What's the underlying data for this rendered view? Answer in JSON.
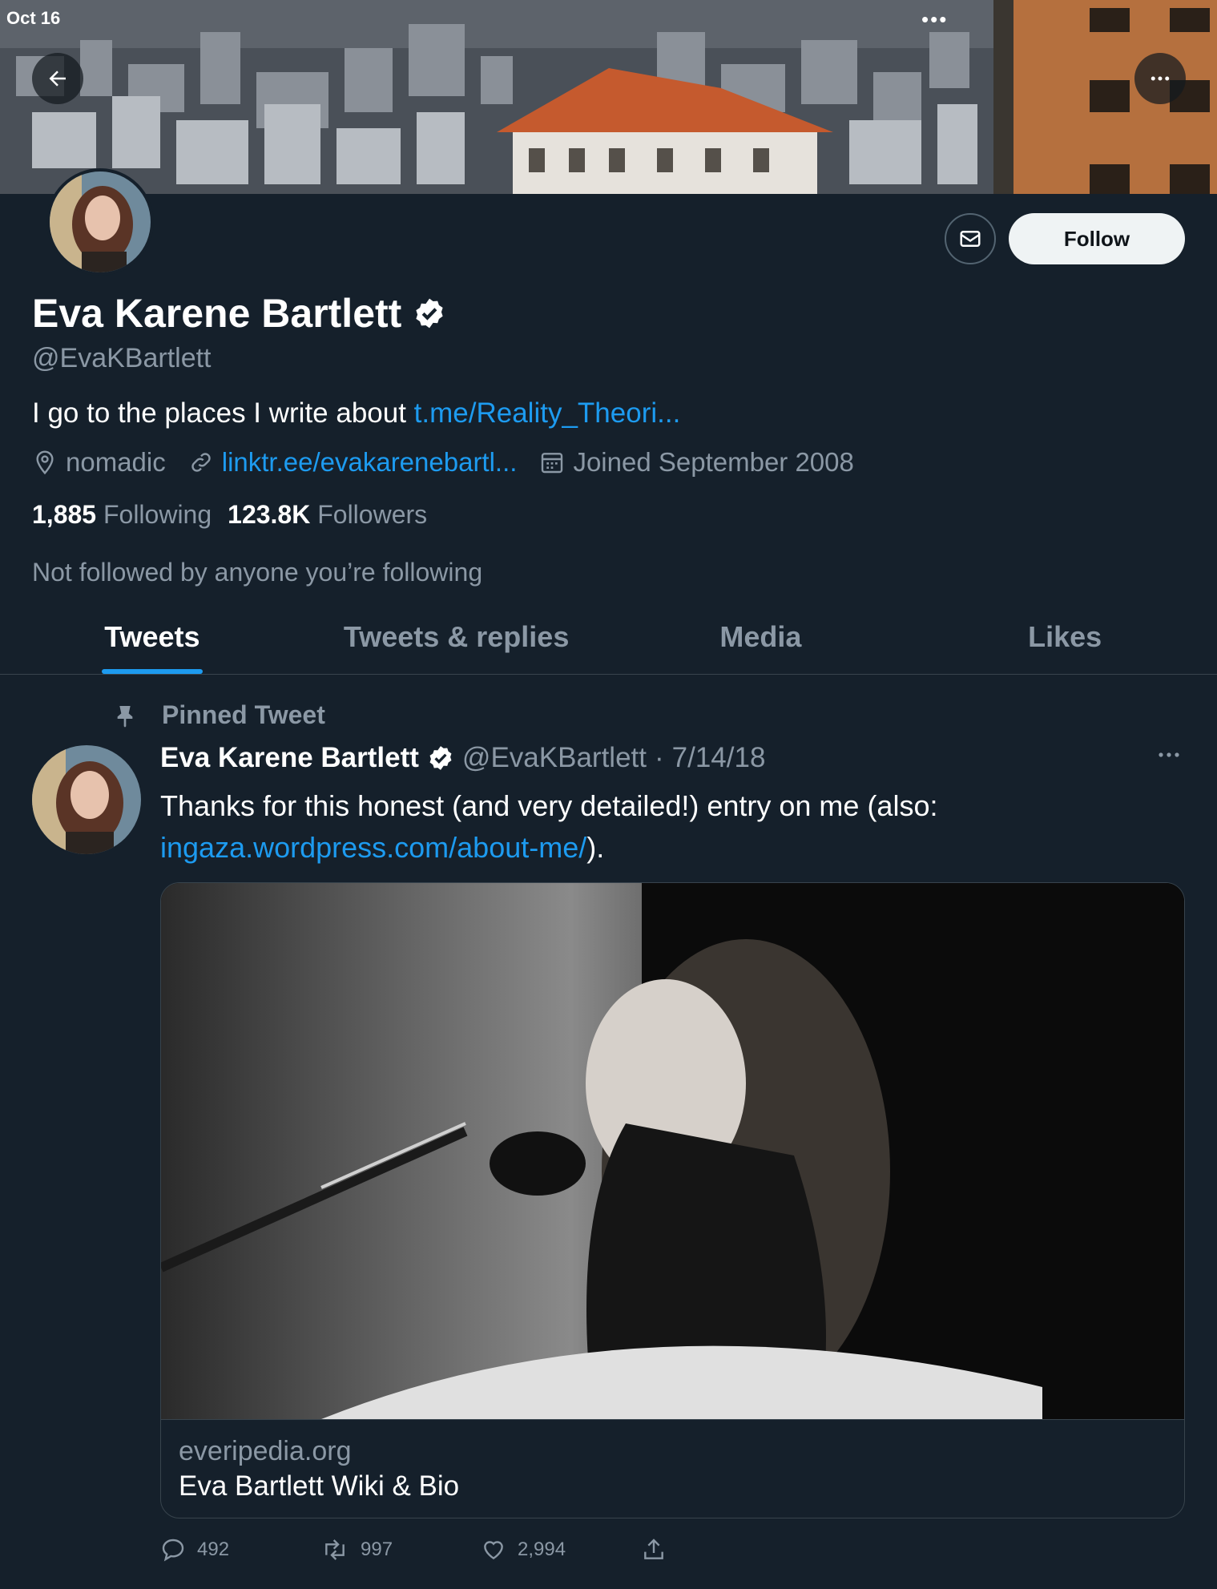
{
  "status_bar": {
    "time": "Oct 16",
    "dots": "•••"
  },
  "profile": {
    "name": "Eva Karene Bartlett",
    "handle": "@EvaKBartlett",
    "bio_text": "I go to the places I write about ",
    "bio_link": "t.me/Reality_Theori...",
    "location": "nomadic",
    "website": "linktr.ee/evakarenebartl...",
    "joined": "Joined September 2008",
    "following_count": "1,885",
    "following_label": "Following",
    "followers_count": "123.8K",
    "followers_label": "Followers",
    "not_followed": "Not followed by anyone you’re following"
  },
  "buttons": {
    "follow": "Follow"
  },
  "tabs": [
    {
      "label": "Tweets"
    },
    {
      "label": "Tweets & replies"
    },
    {
      "label": "Media"
    },
    {
      "label": "Likes"
    }
  ],
  "pinned": {
    "label": "Pinned Tweet",
    "author": "Eva Karene Bartlett",
    "handle": "@EvaKBartlett",
    "separator": "·",
    "date": "7/14/18",
    "text_before": "Thanks for this honest (and very detailed!) entry on me (also: ",
    "text_link": "ingaza.wordpress.com/about-me/",
    "text_after": ").",
    "card_domain": "everipedia.org",
    "card_title": "Eva Bartlett Wiki & Bio",
    "replies": "492",
    "retweets": "997",
    "likes": "2,994"
  },
  "icons": {
    "back": "back-arrow-icon",
    "more": "more-icon",
    "message": "mail-icon",
    "verified": "verified-badge-icon",
    "location": "location-pin-icon",
    "link": "link-icon",
    "calendar": "calendar-icon",
    "pin": "pin-icon",
    "reply": "reply-icon",
    "retweet": "retweet-icon",
    "like": "heart-icon",
    "share": "share-icon"
  },
  "colors": {
    "background": "#15202b",
    "accent": "#1d9bf0",
    "secondary_text": "#8b98a5",
    "border": "#38444d"
  }
}
